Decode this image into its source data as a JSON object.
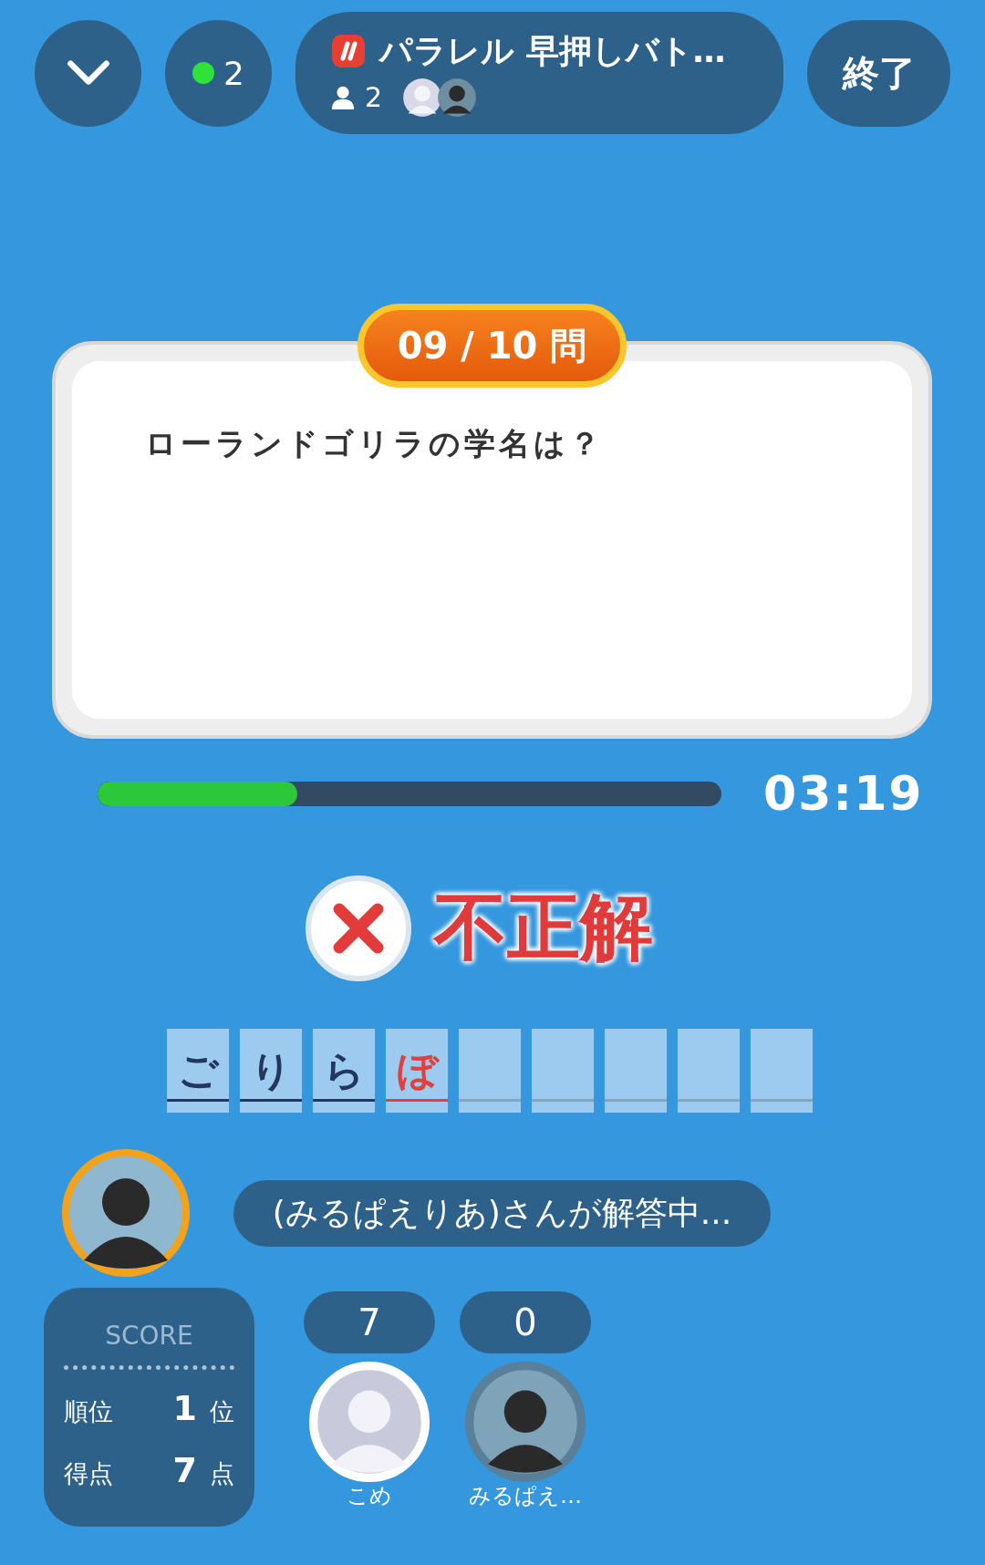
{
  "top_bar": {
    "online": {
      "count": "2"
    },
    "room": {
      "title": "パラレル 早押しバト…",
      "participants": "2"
    },
    "end_button": "終了"
  },
  "question": {
    "counter": "09 / 10 問",
    "text": "ローランドゴリラの学名は？"
  },
  "timer": {
    "level": 0.32,
    "time": "03:19"
  },
  "result": {
    "kind": "incorrect",
    "label": "不正解"
  },
  "answer_tiles": [
    {
      "char": "ご",
      "kind": "correct"
    },
    {
      "char": "り",
      "kind": "correct"
    },
    {
      "char": "ら",
      "kind": "correct"
    },
    {
      "char": "ぼ",
      "kind": "wrong"
    },
    {
      "kind": "empty"
    },
    {
      "kind": "empty"
    },
    {
      "kind": "empty"
    },
    {
      "kind": "empty"
    },
    {
      "kind": "empty"
    }
  ],
  "status": "(みるぱえりあ)さんが解答中...",
  "score": {
    "title": "SCORE",
    "rows": [
      {
        "label": "順位",
        "value": "1",
        "unit": "位"
      },
      {
        "label": "得点",
        "value": "7",
        "unit": "点"
      }
    ]
  },
  "players": [
    {
      "score": "7",
      "name": "こめ",
      "kind": "self"
    },
    {
      "score": "0",
      "name": "みるぱえ…",
      "kind": "other"
    }
  ]
}
